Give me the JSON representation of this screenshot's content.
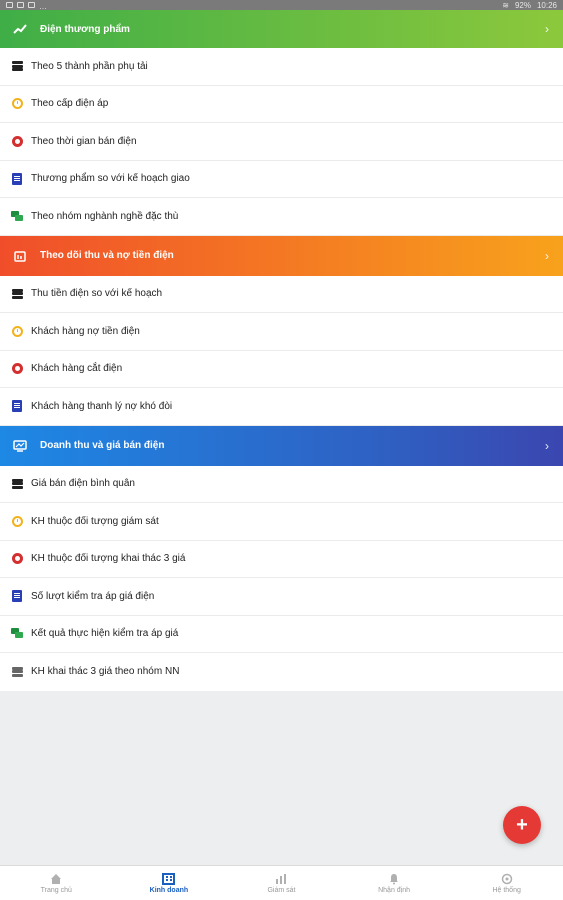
{
  "status_bar": {
    "battery": "92%",
    "time": "10:26"
  },
  "sections": [
    {
      "title": "Điện thương phẩm",
      "icon": "trending-up-icon",
      "color": "#3fae47",
      "items": [
        {
          "label": "Theo 5 thành phần phụ tải",
          "icon": "layers-icon"
        },
        {
          "label": "Theo cấp điện áp",
          "icon": "clock-icon"
        },
        {
          "label": "Theo thời gian bán điện",
          "icon": "lifebuoy-icon"
        },
        {
          "label": "Thương phẩm so với kế hoạch giao",
          "icon": "document-icon"
        },
        {
          "label": "Theo nhóm nghành nghề đặc thù",
          "icon": "chat-icon"
        }
      ]
    },
    {
      "title": "Theo dõi thu và nợ tiền điện",
      "icon": "calendar-icon",
      "color": "#f04e2a",
      "items": [
        {
          "label": "Thu tiền điện so với kế hoạch",
          "icon": "layers-icon"
        },
        {
          "label": "Khách hàng nợ tiền điện",
          "icon": "clock-icon"
        },
        {
          "label": "Khách hàng cắt điện",
          "icon": "lifebuoy-icon"
        },
        {
          "label": "Khách hàng thanh lý nợ khó đòi",
          "icon": "document-icon"
        }
      ]
    },
    {
      "title": "Doanh thu và giá bán điện",
      "icon": "monitor-chart-icon",
      "color": "#1e88e5",
      "items": [
        {
          "label": "Giá bán điện bình quân",
          "icon": "layers-icon"
        },
        {
          "label": "KH thuộc đối tượng giám sát",
          "icon": "clock-icon"
        },
        {
          "label": "KH thuộc đối tượng khai thác 3 giá",
          "icon": "lifebuoy-icon"
        },
        {
          "label": "Số lượt kiểm tra áp giá điện",
          "icon": "document-icon"
        },
        {
          "label": "Kết quả thực hiện kiểm tra áp giá",
          "icon": "chat-icon"
        },
        {
          "label": "KH khai thác 3 giá theo nhóm NN",
          "icon": "layers-icon"
        }
      ]
    }
  ],
  "fab": {
    "label": "+"
  },
  "bottom_nav": [
    {
      "label": "Trang chủ",
      "icon": "home-icon"
    },
    {
      "label": "Kinh doanh",
      "icon": "building-icon",
      "active": true
    },
    {
      "label": "Giám sát",
      "icon": "bar-chart-icon"
    },
    {
      "label": "Nhận định",
      "icon": "bell-icon"
    },
    {
      "label": "Hệ thống",
      "icon": "settings-icon"
    }
  ]
}
